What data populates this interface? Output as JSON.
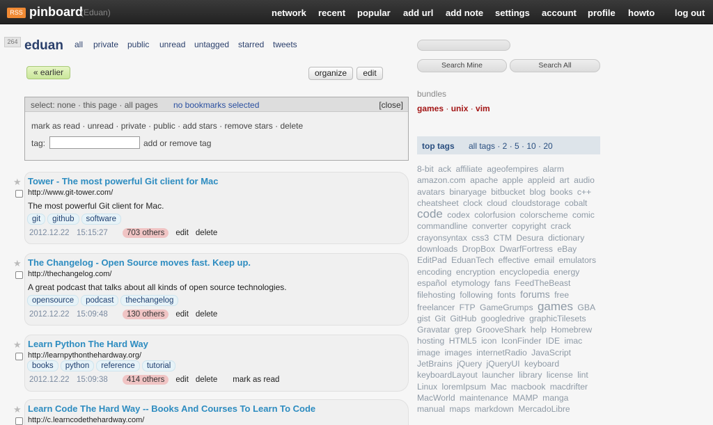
{
  "topbar": {
    "rss": "RSS",
    "brand": "pinboard",
    "user": "(Eduan)",
    "nav": [
      "network",
      "recent",
      "popular",
      "add url",
      "add note",
      "settings",
      "account",
      "profile",
      "howto",
      "log out"
    ]
  },
  "profile": {
    "count": "264",
    "username": "eduan",
    "filters": [
      "all",
      "private",
      "public",
      "unread",
      "untagged",
      "starred",
      "tweets"
    ]
  },
  "buttons": {
    "earlier": "« earlier",
    "organize": "organize",
    "edit": "edit"
  },
  "select_panel": {
    "select_label": "select: none · this page · all pages",
    "no_selection": "no bookmarks selected",
    "close": "[close]",
    "actions": "mark as read · unread · private · public · add stars · remove stars · delete",
    "tag_label": "tag:",
    "tag_action": "add or remove tag"
  },
  "bookmarks": [
    {
      "title": "Tower - The most powerful Git client for Mac",
      "url": "http://www.git-tower.com/",
      "desc": "The most powerful Git client for Mac.",
      "tags": [
        "git",
        "github",
        "software"
      ],
      "date": "2012.12.22",
      "time": "15:15:27",
      "others": "703 others",
      "actions": [
        "edit",
        "delete"
      ]
    },
    {
      "title": "The Changelog - Open Source moves fast. Keep up.",
      "url": "http://thechangelog.com/",
      "desc": "A great podcast that talks about all kinds of open source technologies.",
      "tags": [
        "opensource",
        "podcast",
        "thechangelog"
      ],
      "date": "2012.12.22",
      "time": "15:09:48",
      "others": "130 others",
      "actions": [
        "edit",
        "delete"
      ]
    },
    {
      "title": "Learn Python The Hard Way",
      "url": "http://learnpythonthehardway.org/",
      "desc": "",
      "tags": [
        "books",
        "python",
        "reference",
        "tutorial"
      ],
      "date": "2012.12.22",
      "time": "15:09:38",
      "others": "414 others",
      "actions": [
        "edit",
        "delete",
        "mark as read"
      ]
    },
    {
      "title": "Learn Code The Hard Way -- Books And Courses To Learn To Code",
      "url": "http://c.learncodethehardway.com/",
      "desc": "",
      "tags": [],
      "date": "",
      "time": "",
      "others": "",
      "actions": []
    }
  ],
  "sidebar": {
    "search_mine": "Search Mine",
    "search_all": "Search All",
    "bundles_heading": "bundles",
    "bundles": [
      "games",
      "unix",
      "vim"
    ],
    "bundle_sep": " · ",
    "top_tags": "top tags",
    "all_tags": "all tags · 2 · 5 · 10 · 20",
    "cloud": [
      {
        "t": "8-bit"
      },
      {
        "t": "ack"
      },
      {
        "t": "affiliate"
      },
      {
        "t": "ageofempires"
      },
      {
        "t": "alarm"
      },
      {
        "t": "amazon.com"
      },
      {
        "t": "apache"
      },
      {
        "t": "apple"
      },
      {
        "t": "appleid"
      },
      {
        "t": "art"
      },
      {
        "t": "audio"
      },
      {
        "t": "avatars"
      },
      {
        "t": "binaryage"
      },
      {
        "t": "bitbucket"
      },
      {
        "t": "blog"
      },
      {
        "t": "books"
      },
      {
        "t": "c++"
      },
      {
        "t": "cheatsheet"
      },
      {
        "t": "clock"
      },
      {
        "t": "cloud"
      },
      {
        "t": "cloudstorage"
      },
      {
        "t": "cobalt"
      },
      {
        "t": "code",
        "s": "big"
      },
      {
        "t": "codex"
      },
      {
        "t": "colorfusion"
      },
      {
        "t": "colorscheme"
      },
      {
        "t": "comic"
      },
      {
        "t": "commandline"
      },
      {
        "t": "converter"
      },
      {
        "t": "copyright"
      },
      {
        "t": "crack"
      },
      {
        "t": "crayonsyntax"
      },
      {
        "t": "css3"
      },
      {
        "t": "CTM"
      },
      {
        "t": "Desura"
      },
      {
        "t": "dictionary"
      },
      {
        "t": "downloads"
      },
      {
        "t": "DropBox"
      },
      {
        "t": "DwarfFortress"
      },
      {
        "t": "eBay"
      },
      {
        "t": "EditPad"
      },
      {
        "t": "EduanTech"
      },
      {
        "t": "effective"
      },
      {
        "t": "email"
      },
      {
        "t": "emulators"
      },
      {
        "t": "encoding"
      },
      {
        "t": "encryption"
      },
      {
        "t": "encyclopedia"
      },
      {
        "t": "energy"
      },
      {
        "t": "español"
      },
      {
        "t": "etymology"
      },
      {
        "t": "fans"
      },
      {
        "t": "FeedTheBeast"
      },
      {
        "t": "filehosting"
      },
      {
        "t": "following"
      },
      {
        "t": "fonts"
      },
      {
        "t": "forums",
        "s": "med"
      },
      {
        "t": "free"
      },
      {
        "t": "freelancer"
      },
      {
        "t": "FTP"
      },
      {
        "t": "GameGrumps"
      },
      {
        "t": "games",
        "s": "big"
      },
      {
        "t": "GBA"
      },
      {
        "t": "gist"
      },
      {
        "t": "Git"
      },
      {
        "t": "GitHub"
      },
      {
        "t": "googledrive"
      },
      {
        "t": "graphicTilesets"
      },
      {
        "t": "Gravatar"
      },
      {
        "t": "grep"
      },
      {
        "t": "GrooveShark"
      },
      {
        "t": "help"
      },
      {
        "t": "Homebrew"
      },
      {
        "t": "hosting"
      },
      {
        "t": "HTML5"
      },
      {
        "t": "icon"
      },
      {
        "t": "IconFinder"
      },
      {
        "t": "IDE"
      },
      {
        "t": "imac"
      },
      {
        "t": "image"
      },
      {
        "t": "images"
      },
      {
        "t": "internetRadio"
      },
      {
        "t": "JavaScript"
      },
      {
        "t": "JetBrains"
      },
      {
        "t": "jQuery"
      },
      {
        "t": "jQueryUI"
      },
      {
        "t": "keyboard"
      },
      {
        "t": "keyboardLayout"
      },
      {
        "t": "launcher"
      },
      {
        "t": "library"
      },
      {
        "t": "license"
      },
      {
        "t": "lint"
      },
      {
        "t": "Linux"
      },
      {
        "t": "loremIpsum"
      },
      {
        "t": "Mac"
      },
      {
        "t": "macbook"
      },
      {
        "t": "macdrifter"
      },
      {
        "t": "MacWorld"
      },
      {
        "t": "maintenance"
      },
      {
        "t": "MAMP"
      },
      {
        "t": "manga"
      },
      {
        "t": "manual"
      },
      {
        "t": "maps"
      },
      {
        "t": "markdown"
      },
      {
        "t": "MercadoLibre"
      }
    ]
  }
}
